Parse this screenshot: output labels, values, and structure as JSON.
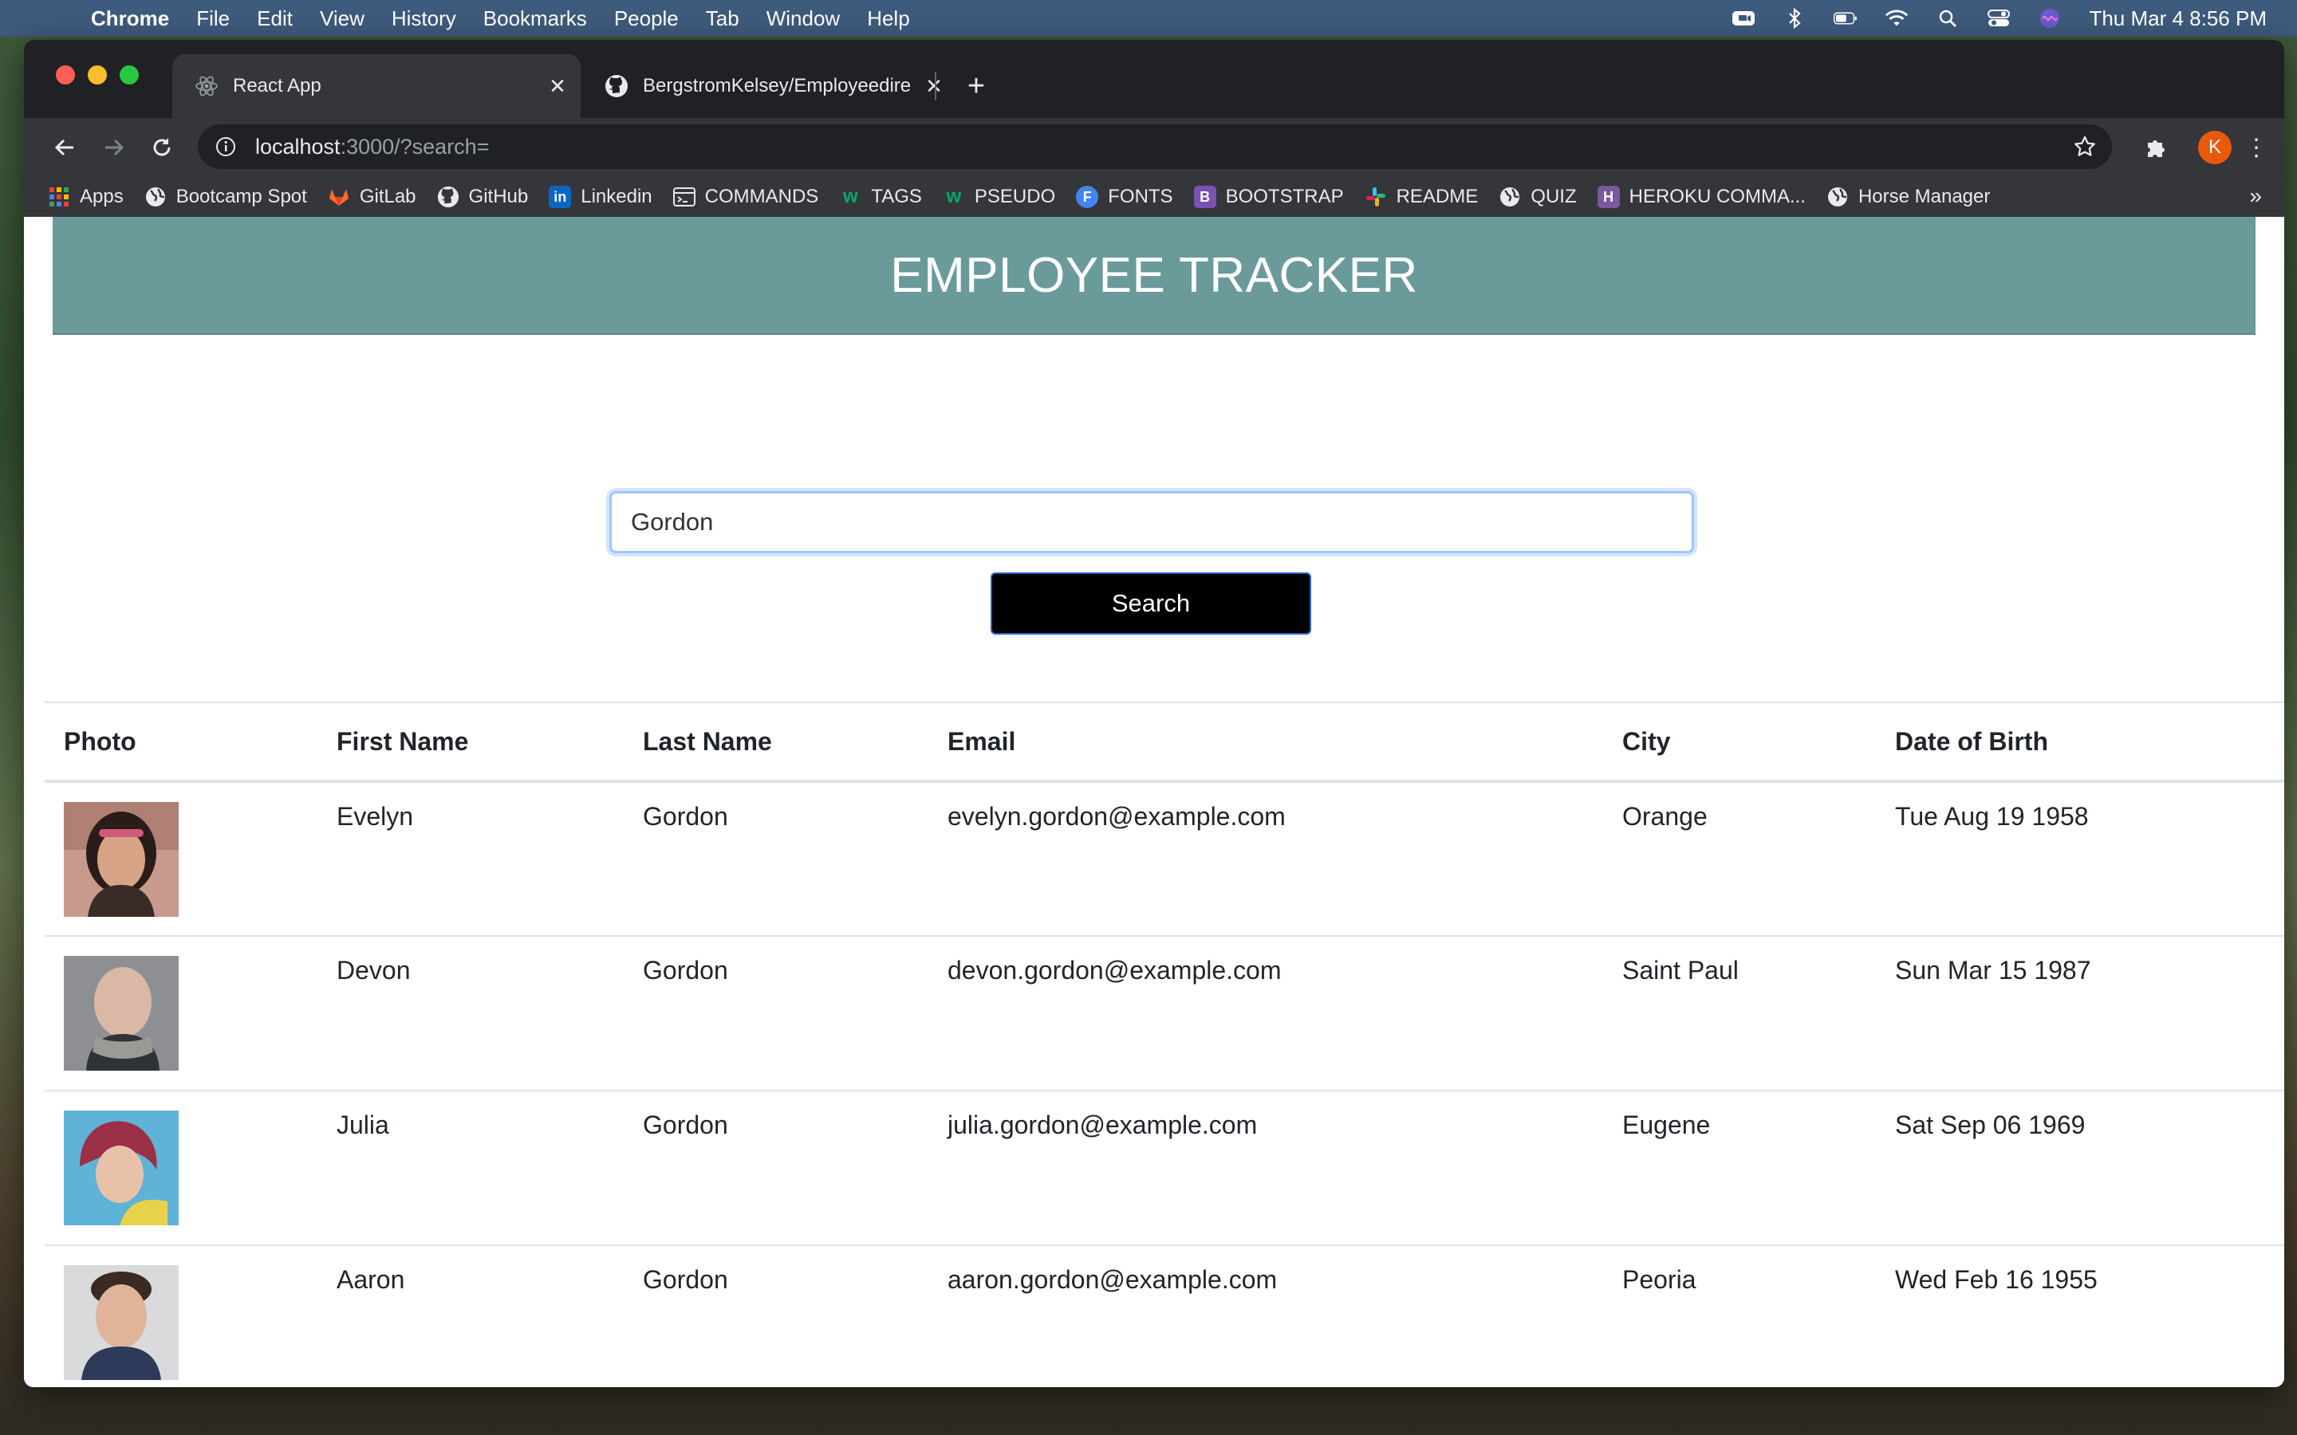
{
  "menubar": {
    "app": "Chrome",
    "items": [
      "File",
      "Edit",
      "View",
      "History",
      "Bookmarks",
      "People",
      "Tab",
      "Window",
      "Help"
    ],
    "clock": "Thu Mar 4  8:56 PM"
  },
  "tabs": [
    {
      "title": "React App",
      "icon": "react-icon"
    },
    {
      "title": "BergstromKelsey/Employeedire",
      "icon": "github-icon"
    }
  ],
  "omnibox": {
    "host": "localhost",
    "path": ":3000/?search="
  },
  "profile_initial": "K",
  "bookmarks": [
    {
      "label": "Apps",
      "icon": "apps-grid-icon"
    },
    {
      "label": "Bootcamp Spot",
      "icon": "globe-icon"
    },
    {
      "label": "GitLab",
      "icon": "gitlab-icon"
    },
    {
      "label": "GitHub",
      "icon": "github-icon"
    },
    {
      "label": "Linkedin",
      "icon": "linkedin-icon"
    },
    {
      "label": "COMMANDS",
      "icon": "terminal-icon"
    },
    {
      "label": "TAGS",
      "icon": "w3schools-icon"
    },
    {
      "label": "PSEUDO",
      "icon": "w3schools-icon"
    },
    {
      "label": "FONTS",
      "icon": "fonts-icon"
    },
    {
      "label": "BOOTSTRAP",
      "icon": "bootstrap-icon"
    },
    {
      "label": "README",
      "icon": "slack-icon"
    },
    {
      "label": "QUIZ",
      "icon": "globe-icon"
    },
    {
      "label": "HEROKU COMMA...",
      "icon": "heroku-icon"
    },
    {
      "label": "Horse Manager",
      "icon": "globe-icon"
    }
  ],
  "bookmarks_more": "»",
  "page": {
    "title": "EMPLOYEE TRACKER",
    "search": {
      "value": "Gordon",
      "button": "Search"
    },
    "columns": [
      "Photo",
      "First Name",
      "Last Name",
      "Email",
      "City",
      "Date of Birth"
    ],
    "rows": [
      {
        "first": "Evelyn",
        "last": "Gordon",
        "email": "evelyn.gordon@example.com",
        "city": "Orange",
        "dob": "Tue Aug 19 1958"
      },
      {
        "first": "Devon",
        "last": "Gordon",
        "email": "devon.gordon@example.com",
        "city": "Saint Paul",
        "dob": "Sun Mar 15 1987"
      },
      {
        "first": "Julia",
        "last": "Gordon",
        "email": "julia.gordon@example.com",
        "city": "Eugene",
        "dob": "Sat Sep 06 1969"
      },
      {
        "first": "Aaron",
        "last": "Gordon",
        "email": "aaron.gordon@example.com",
        "city": "Peoria",
        "dob": "Wed Feb 16 1955"
      }
    ]
  },
  "colors": {
    "header": "#6b9a9b",
    "button": "#000000",
    "profile": "#e8590c"
  }
}
